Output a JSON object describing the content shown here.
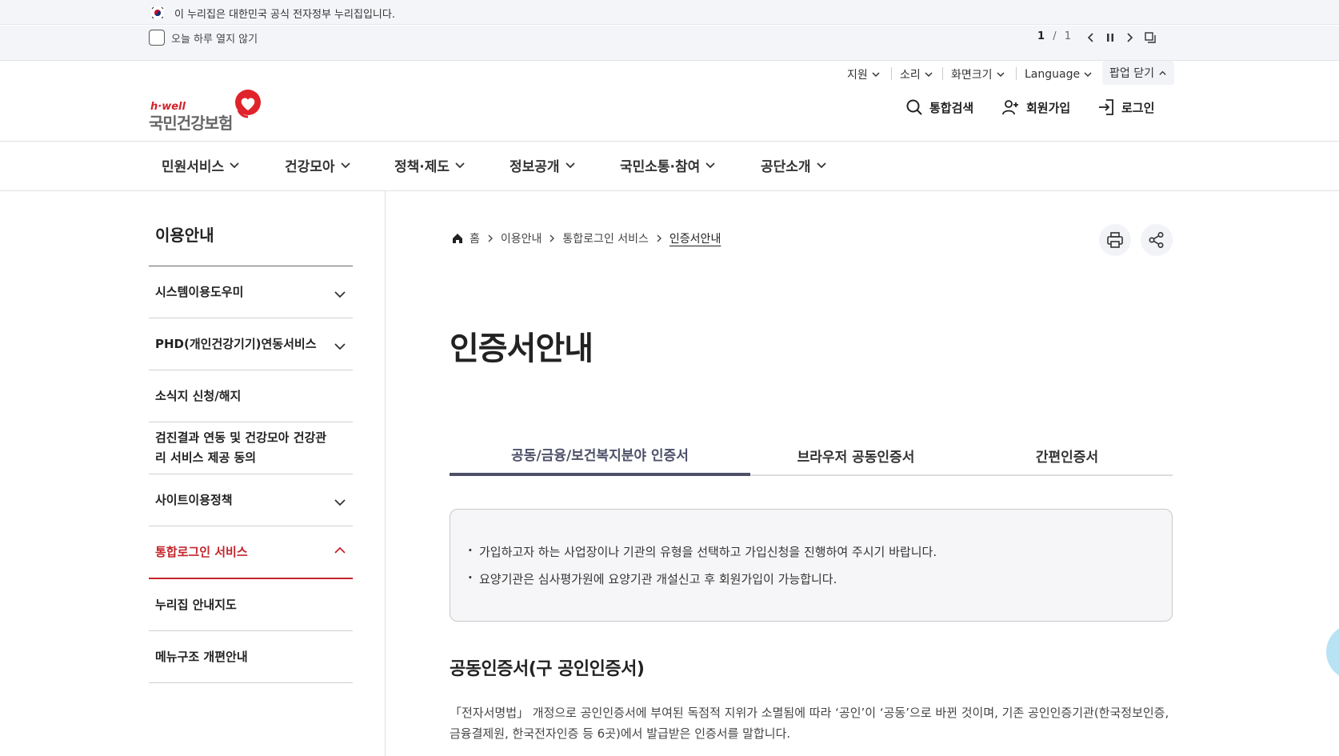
{
  "gov_banner": {
    "text": "이 누리집은 대한민국 공식 전자정부 누리집입니다."
  },
  "popup": {
    "dont_show_today": "오늘 하루 열지 않기",
    "page_current": "1",
    "page_sep": "/",
    "page_total": "1"
  },
  "utility": {
    "support": "지원",
    "sound": "소리",
    "screen_size": "화면크기",
    "language": "Language",
    "popup_close": "팝업 닫기"
  },
  "logo": {
    "brand": "h·well",
    "name": "국민건강보험"
  },
  "header_actions": {
    "search": "통합검색",
    "signup": "회원가입",
    "login": "로그인"
  },
  "gnb": [
    {
      "label": "민원서비스"
    },
    {
      "label": "건강모아"
    },
    {
      "label": "정책·제도"
    },
    {
      "label": "정보공개"
    },
    {
      "label": "국민소통·참여"
    },
    {
      "label": "공단소개"
    }
  ],
  "sidebar": {
    "title": "이용안내",
    "items": [
      {
        "label": "시스템이용도우미"
      },
      {
        "label": "PHD(개인건강기기)연동서비스"
      },
      {
        "label": "소식지 신청/해지"
      },
      {
        "label": "검진결과 연동 및 건강모아 건강관리 서비스 제공 동의"
      },
      {
        "label": "사이트이용정책"
      },
      {
        "label": "통합로그인 서비스"
      },
      {
        "label": "누리집 안내지도"
      },
      {
        "label": "메뉴구조 개편안내"
      }
    ]
  },
  "breadcrumb": {
    "home": "홈",
    "level1": "이용안내",
    "level2": "통합로그인 서비스",
    "current": "인증서안내"
  },
  "page_title": "인증서안내",
  "tabs": [
    {
      "label": "공동/금융/보건복지분야 인증서"
    },
    {
      "label": "브라우저 공동인증서"
    },
    {
      "label": "간편인증서"
    }
  ],
  "info_box": {
    "line1": "가입하고자 하는 사업장이나 기관의 유형을 선택하고 가입신청을 진행하여 주시기 바랍니다.",
    "line2": "요양기관은 심사평가원에 요양기관 개설신고 후 회원가입이 가능합니다."
  },
  "section": {
    "title": "공동인증서(구 공인인증서)",
    "body": "「전자서명법」 개정으로 공인인증서에 부여된 독점적 지위가 소멸됨에 따라 ‘공인’이 ‘공동’으로 바뀐 것이며, 기존 공인인증기관(한국정보인증, 금융결제원, 한국전자인증 등 6곳)에서 발급받은 인증서를 말합니다."
  },
  "colors": {
    "brand_red": "#c3252c",
    "tab_active": "#4d5068"
  }
}
